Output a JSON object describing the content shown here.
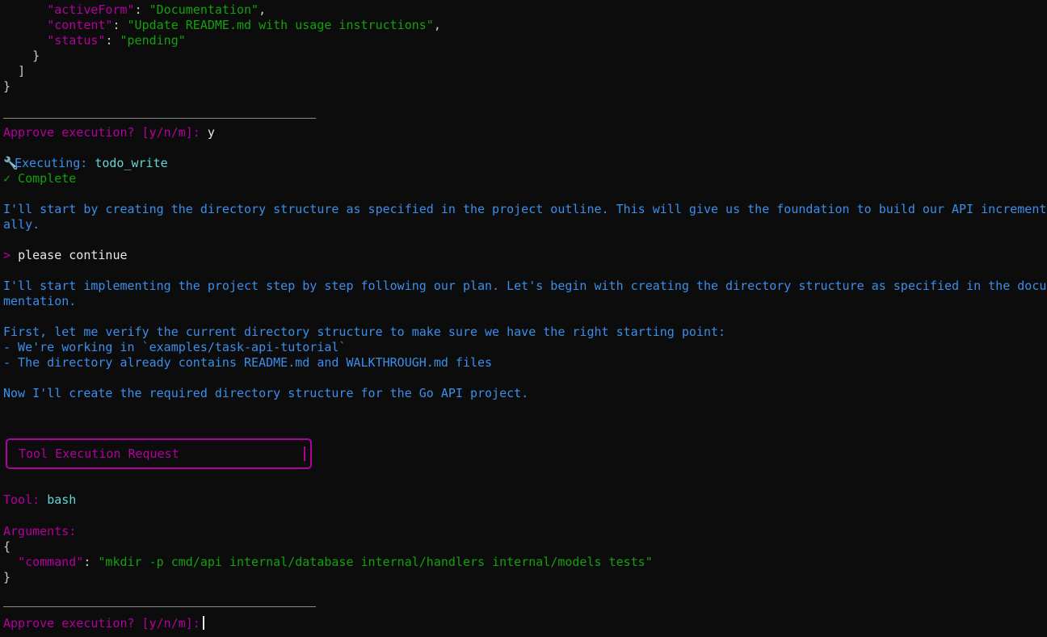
{
  "json_tail": {
    "activeForm_key": "\"activeForm\"",
    "activeForm_val": "\"Documentation\"",
    "content_key": "\"content\"",
    "content_val": "\"Update README.md with usage instructions\"",
    "status_key": "\"status\"",
    "status_val": "\"pending\"",
    "close_obj": "}",
    "close_arr": "]",
    "close_root": "}"
  },
  "approve1": {
    "prompt": "Approve execution? [y/n/m]:",
    "answer": "y"
  },
  "executing": {
    "icon": "wrench-icon",
    "label": "Executing:",
    "tool": "todo_write",
    "status": "✓ Complete"
  },
  "assistant1": {
    "line1": "I'll start by creating the directory structure as specified in the project outline. This will give us the foundation to build our API increment",
    "line2": "ally."
  },
  "user": {
    "prompt_char": ">",
    "text": "please continue"
  },
  "assistant2": {
    "line1": "I'll start implementing the project step by step following our plan. Let's begin with creating the directory structure as specified in the docu",
    "line2": "mentation.",
    "line3": "First, let me verify the current directory structure to make sure we have the right starting point:",
    "line4": "- We're working in `examples/task-api-tutorial`",
    "line5": "- The directory already contains README.md and WALKTHROUGH.md files",
    "line6": "Now I'll create the required directory structure for the Go API project."
  },
  "tool_request": {
    "title": "Tool Execution Request",
    "tool_label": "Tool:",
    "tool_name": "bash",
    "args_label": "Arguments:",
    "open": "{",
    "cmd_key": "\"command\"",
    "cmd_val": "\"mkdir -p cmd/api internal/database internal/handlers internal/models tests\"",
    "close": "}"
  },
  "approve2": {
    "prompt": "Approve execution? [y/n/m]:"
  },
  "colors": {
    "background": "#0c0c0c",
    "magenta": "#b4009e",
    "blue": "#3b8eea",
    "green": "#13a10e",
    "cyan": "#61d6d6"
  }
}
